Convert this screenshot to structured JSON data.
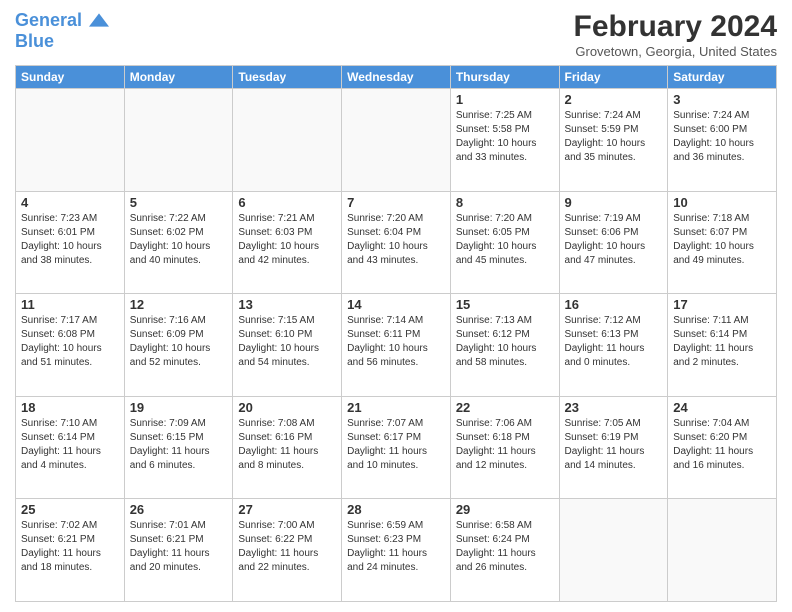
{
  "logo": {
    "line1": "General",
    "line2": "Blue"
  },
  "title": "February 2024",
  "subtitle": "Grovetown, Georgia, United States",
  "weekdays": [
    "Sunday",
    "Monday",
    "Tuesday",
    "Wednesday",
    "Thursday",
    "Friday",
    "Saturday"
  ],
  "weeks": [
    [
      {
        "day": "",
        "info": ""
      },
      {
        "day": "",
        "info": ""
      },
      {
        "day": "",
        "info": ""
      },
      {
        "day": "",
        "info": ""
      },
      {
        "day": "1",
        "info": "Sunrise: 7:25 AM\nSunset: 5:58 PM\nDaylight: 10 hours\nand 33 minutes."
      },
      {
        "day": "2",
        "info": "Sunrise: 7:24 AM\nSunset: 5:59 PM\nDaylight: 10 hours\nand 35 minutes."
      },
      {
        "day": "3",
        "info": "Sunrise: 7:24 AM\nSunset: 6:00 PM\nDaylight: 10 hours\nand 36 minutes."
      }
    ],
    [
      {
        "day": "4",
        "info": "Sunrise: 7:23 AM\nSunset: 6:01 PM\nDaylight: 10 hours\nand 38 minutes."
      },
      {
        "day": "5",
        "info": "Sunrise: 7:22 AM\nSunset: 6:02 PM\nDaylight: 10 hours\nand 40 minutes."
      },
      {
        "day": "6",
        "info": "Sunrise: 7:21 AM\nSunset: 6:03 PM\nDaylight: 10 hours\nand 42 minutes."
      },
      {
        "day": "7",
        "info": "Sunrise: 7:20 AM\nSunset: 6:04 PM\nDaylight: 10 hours\nand 43 minutes."
      },
      {
        "day": "8",
        "info": "Sunrise: 7:20 AM\nSunset: 6:05 PM\nDaylight: 10 hours\nand 45 minutes."
      },
      {
        "day": "9",
        "info": "Sunrise: 7:19 AM\nSunset: 6:06 PM\nDaylight: 10 hours\nand 47 minutes."
      },
      {
        "day": "10",
        "info": "Sunrise: 7:18 AM\nSunset: 6:07 PM\nDaylight: 10 hours\nand 49 minutes."
      }
    ],
    [
      {
        "day": "11",
        "info": "Sunrise: 7:17 AM\nSunset: 6:08 PM\nDaylight: 10 hours\nand 51 minutes."
      },
      {
        "day": "12",
        "info": "Sunrise: 7:16 AM\nSunset: 6:09 PM\nDaylight: 10 hours\nand 52 minutes."
      },
      {
        "day": "13",
        "info": "Sunrise: 7:15 AM\nSunset: 6:10 PM\nDaylight: 10 hours\nand 54 minutes."
      },
      {
        "day": "14",
        "info": "Sunrise: 7:14 AM\nSunset: 6:11 PM\nDaylight: 10 hours\nand 56 minutes."
      },
      {
        "day": "15",
        "info": "Sunrise: 7:13 AM\nSunset: 6:12 PM\nDaylight: 10 hours\nand 58 minutes."
      },
      {
        "day": "16",
        "info": "Sunrise: 7:12 AM\nSunset: 6:13 PM\nDaylight: 11 hours\nand 0 minutes."
      },
      {
        "day": "17",
        "info": "Sunrise: 7:11 AM\nSunset: 6:14 PM\nDaylight: 11 hours\nand 2 minutes."
      }
    ],
    [
      {
        "day": "18",
        "info": "Sunrise: 7:10 AM\nSunset: 6:14 PM\nDaylight: 11 hours\nand 4 minutes."
      },
      {
        "day": "19",
        "info": "Sunrise: 7:09 AM\nSunset: 6:15 PM\nDaylight: 11 hours\nand 6 minutes."
      },
      {
        "day": "20",
        "info": "Sunrise: 7:08 AM\nSunset: 6:16 PM\nDaylight: 11 hours\nand 8 minutes."
      },
      {
        "day": "21",
        "info": "Sunrise: 7:07 AM\nSunset: 6:17 PM\nDaylight: 11 hours\nand 10 minutes."
      },
      {
        "day": "22",
        "info": "Sunrise: 7:06 AM\nSunset: 6:18 PM\nDaylight: 11 hours\nand 12 minutes."
      },
      {
        "day": "23",
        "info": "Sunrise: 7:05 AM\nSunset: 6:19 PM\nDaylight: 11 hours\nand 14 minutes."
      },
      {
        "day": "24",
        "info": "Sunrise: 7:04 AM\nSunset: 6:20 PM\nDaylight: 11 hours\nand 16 minutes."
      }
    ],
    [
      {
        "day": "25",
        "info": "Sunrise: 7:02 AM\nSunset: 6:21 PM\nDaylight: 11 hours\nand 18 minutes."
      },
      {
        "day": "26",
        "info": "Sunrise: 7:01 AM\nSunset: 6:21 PM\nDaylight: 11 hours\nand 20 minutes."
      },
      {
        "day": "27",
        "info": "Sunrise: 7:00 AM\nSunset: 6:22 PM\nDaylight: 11 hours\nand 22 minutes."
      },
      {
        "day": "28",
        "info": "Sunrise: 6:59 AM\nSunset: 6:23 PM\nDaylight: 11 hours\nand 24 minutes."
      },
      {
        "day": "29",
        "info": "Sunrise: 6:58 AM\nSunset: 6:24 PM\nDaylight: 11 hours\nand 26 minutes."
      },
      {
        "day": "",
        "info": ""
      },
      {
        "day": "",
        "info": ""
      }
    ]
  ]
}
